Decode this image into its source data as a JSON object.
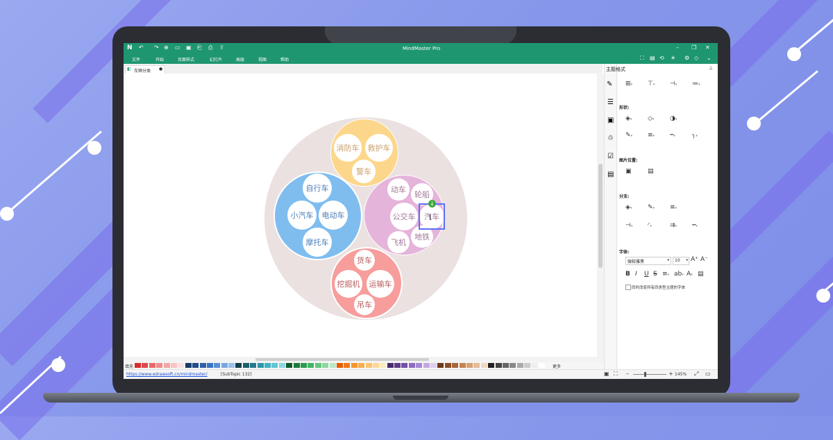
{
  "colors": {
    "brand": "#1e9670",
    "transport_big": "#ebe1e1",
    "fire_group": "#fcd78b",
    "car_group": "#7fbdef",
    "public_group": "#e5b4da",
    "truck_group": "#f79d9b"
  },
  "app": {
    "title": "MindMaster Pro",
    "menu": [
      "文件",
      "开始",
      "页面样式",
      "幻灯片",
      "高级",
      "视图",
      "帮助"
    ],
    "doc_tab": "车辆分类"
  },
  "mindmap": {
    "fire_group": [
      "消防车",
      "救护车",
      "警车"
    ],
    "car_group": [
      "自行车",
      "小汽车",
      "电动车",
      "摩托车"
    ],
    "public_group": [
      "动车",
      "轮船",
      "公交车",
      "汽车",
      "飞机",
      "地铁"
    ],
    "truck_group": [
      "货车",
      "挖掘机",
      "运输车",
      "吊车"
    ]
  },
  "panel": {
    "title": "主题格式",
    "shape": "形状:",
    "image_position": "图片位置:",
    "branch": "分支:",
    "font": "字体:",
    "font_name": "微软雅黑",
    "font_size": "10",
    "apply_font_text": "同时改变所有同类型主题的字体"
  },
  "colorbar": {
    "fill_label": "填充",
    "more_label": "更多"
  },
  "status": {
    "link": "https://www.edrawsoft.cn/mindmaster/",
    "topic": "[SubTopic 132]",
    "zoom": "145%"
  }
}
